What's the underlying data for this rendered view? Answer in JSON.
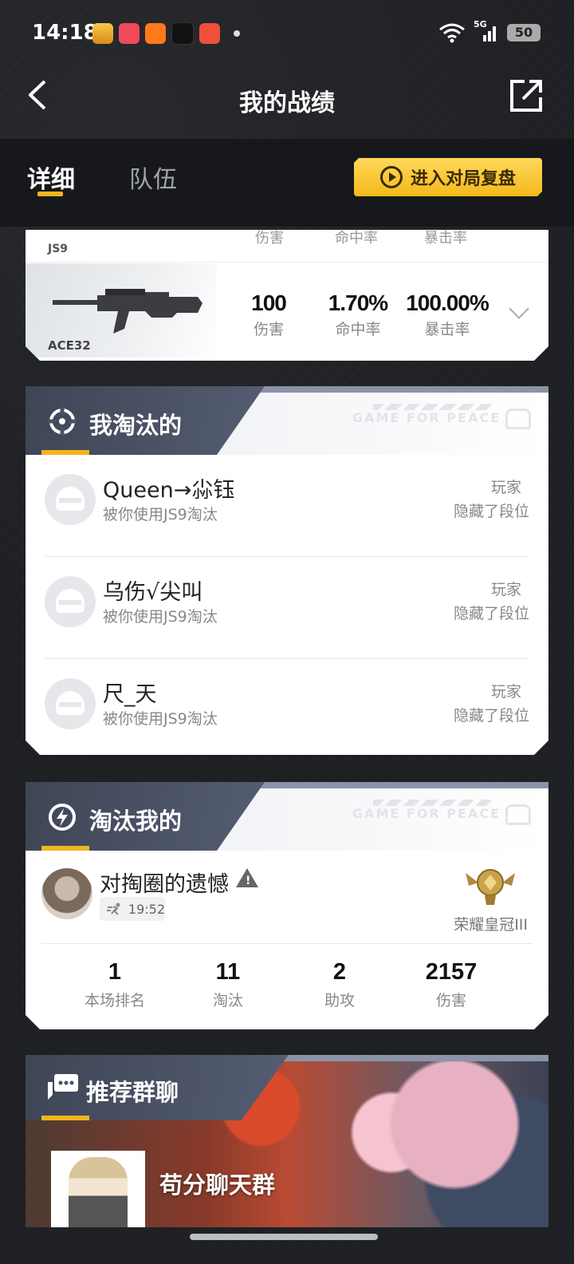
{
  "status_bar": {
    "time": "14:18",
    "network": "5G",
    "battery": "50"
  },
  "header": {
    "title": "我的战绩"
  },
  "tabs": {
    "detail": "详细",
    "team": "队伍"
  },
  "replay_button": "进入对局复盘",
  "weapons": {
    "partial": {
      "name": "JS9",
      "labels": [
        "伤害",
        "命中率",
        "暴击率"
      ]
    },
    "ace32": {
      "name": "ACE32",
      "damage": "100",
      "damage_label": "伤害",
      "hit_rate": "1.70%",
      "hit_rate_label": "命中率",
      "crit_rate": "100.00%",
      "crit_rate_label": "暴击率"
    }
  },
  "eliminated": {
    "title": "我淘汰的",
    "watermark": "GAME FOR PEACE",
    "players": [
      {
        "name": "Queen→尛钰",
        "desc": "被你使用JS9淘汰",
        "role": "玩家",
        "rank": "隐藏了段位"
      },
      {
        "name": "乌伤√尖叫",
        "desc": "被你使用JS9淘汰",
        "role": "玩家",
        "rank": "隐藏了段位"
      },
      {
        "name": "尺_天",
        "desc": "被你使用JS9淘汰",
        "role": "玩家",
        "rank": "隐藏了段位"
      }
    ]
  },
  "killed_by": {
    "title": "淘汰我的",
    "watermark": "GAME FOR PEACE",
    "name": "对掏圈的遗憾",
    "time": "19:52",
    "rank": "荣耀皇冠III",
    "stats": [
      {
        "value": "1",
        "label": "本场排名"
      },
      {
        "value": "11",
        "label": "淘汰"
      },
      {
        "value": "2",
        "label": "助攻"
      },
      {
        "value": "2157",
        "label": "伤害"
      }
    ]
  },
  "group_chat": {
    "title": "推荐群聊",
    "name": "苟分聊天群"
  },
  "colors": {
    "accent": "#f2b51e",
    "dark_bg": "#1e2024",
    "header_band": "#4a5165"
  }
}
